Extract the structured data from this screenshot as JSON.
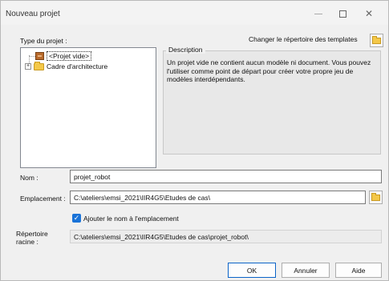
{
  "window": {
    "title": "Nouveau projet"
  },
  "labels": {
    "project_type": "Type du projet :",
    "change_templates": "Changer le répertoire des templates",
    "description": "Description",
    "name": "Nom :",
    "location": "Emplacement :",
    "root_dir": "Répertoire racine :"
  },
  "tree": {
    "items": [
      {
        "label": "<Projet vide>",
        "icon": "box-icon",
        "selected": true
      },
      {
        "label": "Cadre d'architecture",
        "icon": "folder-icon",
        "expandable": true
      }
    ]
  },
  "description_text": "Un projet vide ne contient aucun modèle ni document. Vous pouvez l'utiliser comme point de départ pour créer votre propre jeu de modèles interdépendants.",
  "fields": {
    "name_value": "projet_robot",
    "location_value": "C:\\ateliers\\emsi_2021\\IIR4G5\\Etudes de cas\\",
    "root_value": "C:\\ateliers\\emsi_2021\\IIR4G5\\Etudes de cas\\projet_robot\\"
  },
  "checkbox": {
    "label": "Ajouter le nom à l'emplacement",
    "checked": true
  },
  "buttons": {
    "ok": "OK",
    "cancel": "Annuler",
    "help": "Aide"
  },
  "colors": {
    "accent": "#1a73d8",
    "folder": "#f4c849"
  }
}
